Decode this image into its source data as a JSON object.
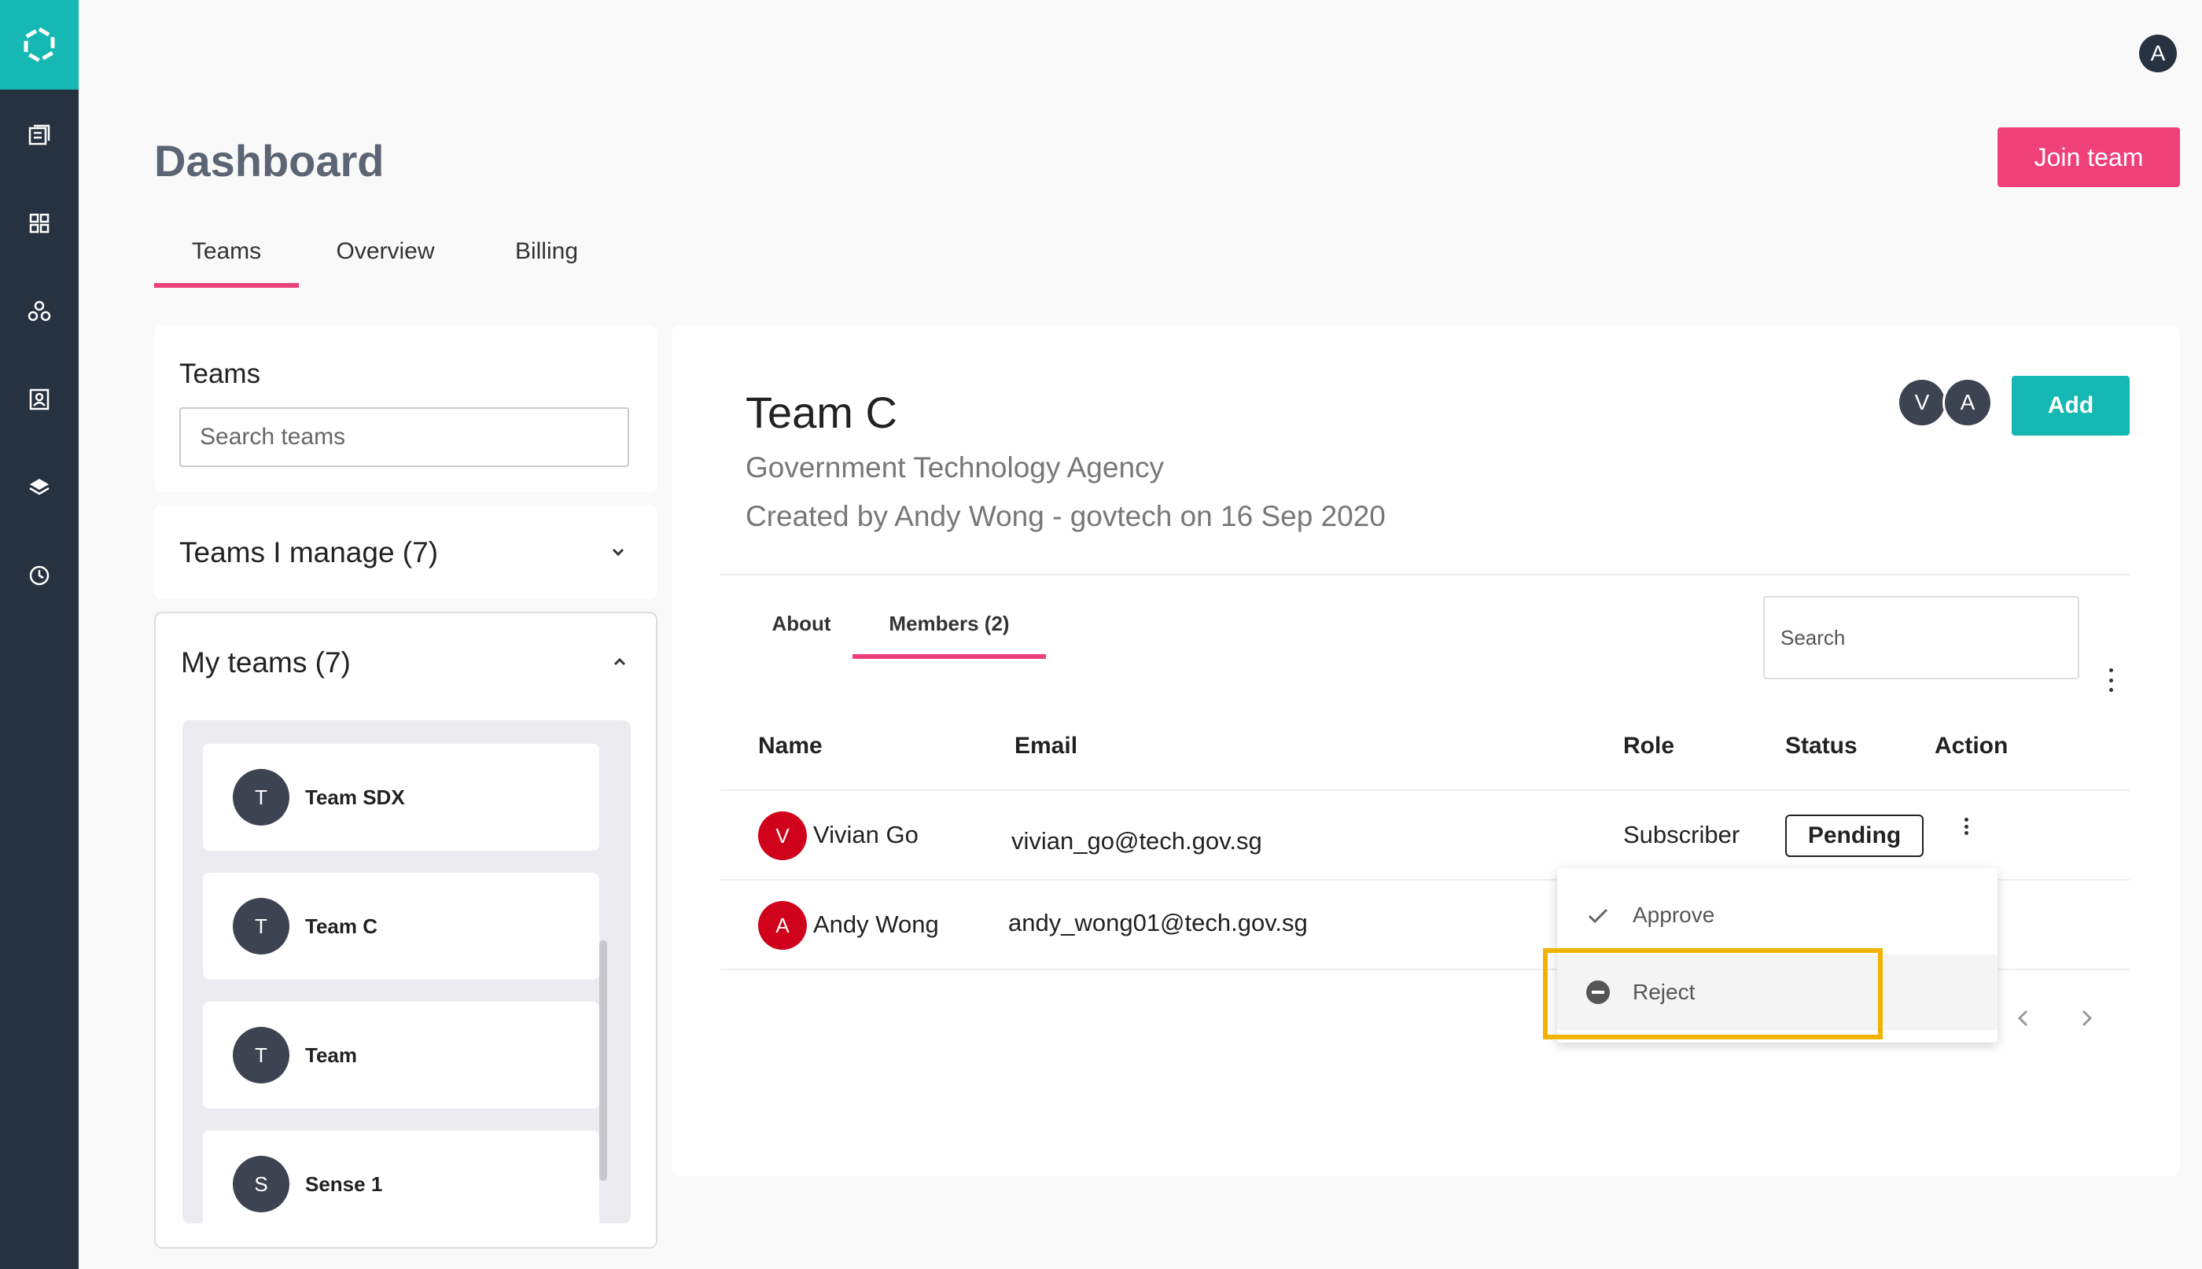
{
  "header": {
    "user_initial": "A",
    "page_title": "Dashboard",
    "join_label": "Join team"
  },
  "main_tabs": [
    "Teams",
    "Overview",
    "Billing"
  ],
  "left": {
    "teams_title": "Teams",
    "search_placeholder": "Search teams",
    "manage_title": "Teams I manage (7)",
    "my_title": "My teams (7)",
    "my_teams": [
      {
        "initial": "T",
        "name": "Team SDX"
      },
      {
        "initial": "T",
        "name": "Team C"
      },
      {
        "initial": "T",
        "name": "Team"
      },
      {
        "initial": "S",
        "name": "Sense 1"
      }
    ]
  },
  "team": {
    "name": "Team C",
    "org": "Government Technology Agency",
    "created": "Created by Andy Wong - govtech on 16 Sep 2020",
    "member_initials": [
      "V",
      "A"
    ],
    "add_label": "Add",
    "tabs": [
      "About",
      "Members (2)"
    ],
    "search_placeholder": "Search",
    "columns": [
      "Name",
      "Email",
      "Role",
      "Status",
      "Action"
    ],
    "members": [
      {
        "initial": "V",
        "name": "Vivian Go",
        "email": "vivian_go@tech.gov.sg",
        "role": "Subscriber",
        "status": "Pending"
      },
      {
        "initial": "A",
        "name": "Andy Wong",
        "email": "andy_wong01@tech.gov.sg",
        "role": "",
        "status": ""
      }
    ]
  },
  "menu": {
    "approve": "Approve",
    "reject": "Reject"
  },
  "colors": {
    "sidebar": "#263240",
    "brand_teal": "#16b8b3",
    "accent_pink": "#f0407a",
    "highlight": "#f0b400",
    "avatar_red": "#d0021b"
  },
  "icons": [
    "logo-icon",
    "catalog-icon",
    "grid-icon",
    "hierarchy-icon",
    "contacts-icon",
    "layers-icon",
    "clock-icon",
    "chevron-down-icon",
    "chevron-up-icon",
    "kebab-menu-icon",
    "check-icon",
    "minus-circle-icon",
    "chevron-left-icon",
    "chevron-right-icon"
  ]
}
